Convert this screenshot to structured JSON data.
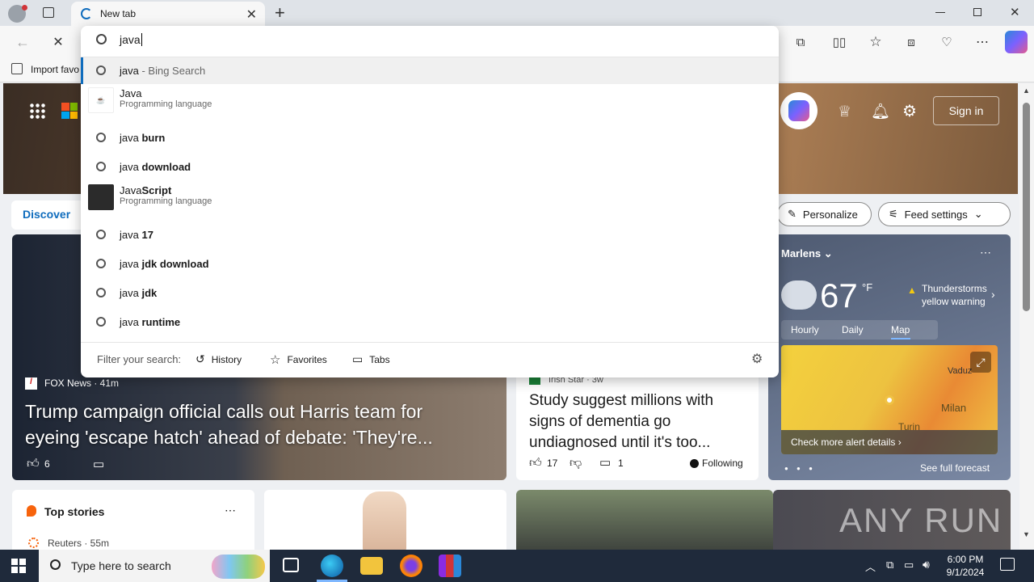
{
  "browser": {
    "tab_title": "New tab",
    "new_tab_symbol": "+",
    "window_controls": [
      "minimize",
      "restore",
      "close"
    ],
    "favorites_bar_item": "Import favo"
  },
  "address_bar": {
    "value": "java"
  },
  "suggestions": [
    {
      "type": "search",
      "prefix": "java",
      "bold": "",
      "suffix": " - Bing Search",
      "highlighted": true
    },
    {
      "type": "entity",
      "title": "Java",
      "bold": "",
      "subtitle": "Programming language",
      "icon": "java-logo"
    },
    {
      "type": "search",
      "prefix": "java ",
      "bold": "burn"
    },
    {
      "type": "search",
      "prefix": "java ",
      "bold": "download"
    },
    {
      "type": "entity",
      "title": "Java",
      "bold": "Script",
      "subtitle": "Programming language",
      "icon": "javascript-logo"
    },
    {
      "type": "search",
      "prefix": "java ",
      "bold": "17"
    },
    {
      "type": "search",
      "prefix": "java ",
      "bold": "jdk download"
    },
    {
      "type": "search",
      "prefix": "java ",
      "bold": "jdk"
    },
    {
      "type": "search",
      "prefix": "java ",
      "bold": "runtime"
    }
  ],
  "filter_bar": {
    "label": "Filter your search:",
    "items": [
      "History",
      "Favorites",
      "Tabs"
    ]
  },
  "newtab": {
    "sign_in": "Sign in",
    "discover": "Discover",
    "personalize": "Personalize",
    "feed_settings": "Feed settings",
    "weather": {
      "location": "Marlens",
      "temp": "67",
      "unit": "°F",
      "alert_line1": "Thunderstorms",
      "alert_line2": "yellow warning",
      "tabs": [
        "Hourly",
        "Daily",
        "Map"
      ],
      "active_tab": "Map",
      "map_label_city": "Milan",
      "map_label_city2": "Turin",
      "map_label_city3": "Vaduz",
      "check_alert": "Check more alert details",
      "see_forecast": "See full forecast"
    },
    "lead_story": {
      "source": "FOX News · 41m",
      "headline": "Trump campaign official calls out Harris team for eyeing 'escape hatch' ahead of debate: 'They're...",
      "likes": "6"
    },
    "second_story": {
      "source": "Irish Star · 3w",
      "headline": "Study suggest millions with signs of dementia go undiagnosed until it's too...",
      "likes": "17",
      "comments": "1",
      "following": "Following"
    },
    "top_stories": {
      "title": "Top stories",
      "source": "Reuters · 55m"
    },
    "watermark": "ANY RUN"
  },
  "taskbar": {
    "search_placeholder": "Type here to search",
    "time": "6:00 PM",
    "date": "9/1/2024"
  },
  "colors": {
    "accent": "#0f6cbd",
    "taskbar": "#1f2a3b",
    "highlight_row": "#f0f0f0"
  }
}
